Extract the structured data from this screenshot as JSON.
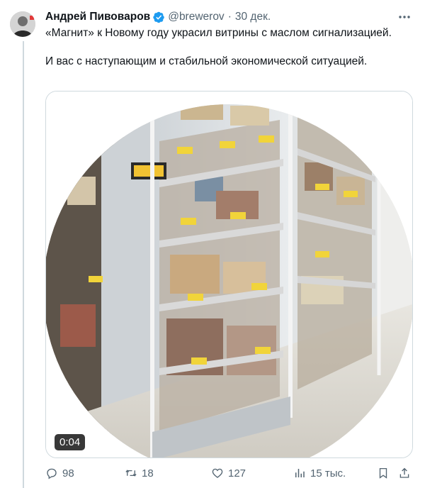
{
  "tweet": {
    "author_name": "Андрей Пивоваров",
    "handle": "@brewerov",
    "separator": "·",
    "date": "30 дек.",
    "text_line1": "«Магнит» к Новому году украсил витрины с маслом сигнализацией.",
    "text_line2": "И вас с наступающим и стабильной экономической ситуацией.",
    "video_duration": "0:04"
  },
  "actions": {
    "replies": "98",
    "reposts": "18",
    "likes": "127",
    "views": "15 тыс."
  },
  "colors": {
    "verified_blue": "#1d9bf0",
    "secondary_text": "#536471",
    "border": "#cfd9de"
  },
  "icons": [
    "verified-icon",
    "more-icon",
    "reply-icon",
    "repost-icon",
    "like-icon",
    "views-icon",
    "bookmark-icon",
    "share-icon"
  ]
}
